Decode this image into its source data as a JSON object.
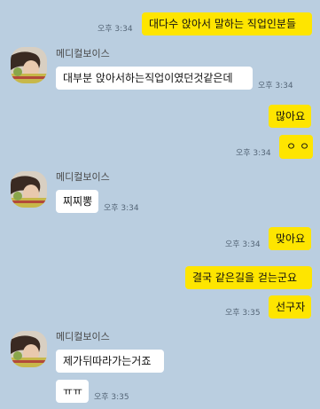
{
  "colors": {
    "background": "#bacee0",
    "bubble_out": "#fee500",
    "bubble_in": "#ffffff",
    "time_text": "#556677"
  },
  "messages": [
    {
      "id": "m1",
      "dir": "out",
      "text": "대다수 앉아서 말하는 직업인분들",
      "time": "오후 3:34"
    },
    {
      "id": "m2",
      "dir": "in",
      "sender": "메디컬보이스",
      "text": "대부분 앉아서하는직업이였던것같은데",
      "time": "오후 3:34"
    },
    {
      "id": "m3",
      "dir": "out",
      "text": "많아요",
      "time": ""
    },
    {
      "id": "m4",
      "dir": "out",
      "text": "ㅇㅇ",
      "time": "오후 3:34"
    },
    {
      "id": "m5",
      "dir": "in",
      "sender": "메디컬보이스",
      "text": "찌찌뽕",
      "time": "오후 3:34"
    },
    {
      "id": "m6",
      "dir": "out",
      "text": "맞아요",
      "time": "오후 3:34"
    },
    {
      "id": "m7",
      "dir": "out",
      "text": "결국 같은길을 걷는군요",
      "time": ""
    },
    {
      "id": "m8",
      "dir": "out",
      "text": "선구자",
      "time": "오후 3:35"
    },
    {
      "id": "m9",
      "dir": "in",
      "sender": "메디컬보이스",
      "text": "제가뒤따라가는거죠",
      "time": ""
    },
    {
      "id": "m10",
      "dir": "in",
      "text": "ㅠㅠ",
      "time": "오후 3:35"
    }
  ]
}
